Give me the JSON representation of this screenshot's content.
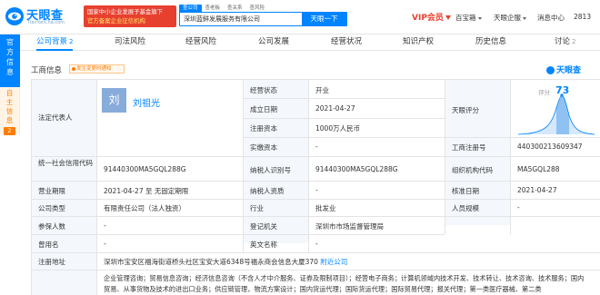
{
  "header": {
    "logo_name": "天眼查",
    "logo_domain": "TianYanCha.com",
    "promo_line1": "国家中小企业发展子基金旗下",
    "promo_line2": "官方备案企业征信机构",
    "search_tabs": [
      "查公司",
      "查老板",
      "查关系",
      "查风险"
    ],
    "search_value": "深圳蓝鲜发展服务有限公司",
    "search_button": "天眼一下",
    "vip_label": "VIP会员",
    "nav_items": [
      "百宝箱",
      "天眼企服",
      "消息中心",
      "2813"
    ],
    "colors": {
      "brand": "#0084ff",
      "promo": "#e8402f",
      "accent_orange": "#ff7d00"
    }
  },
  "sidebar": {
    "tab1": [
      "官",
      "方",
      "信",
      "息"
    ],
    "tab2": [
      "自",
      "主",
      "信",
      "息"
    ],
    "tab2_count": "2"
  },
  "tabs": [
    {
      "label": "公司背景",
      "count": "2"
    },
    {
      "label": "司法风险",
      "count": ""
    },
    {
      "label": "经营风险",
      "count": ""
    },
    {
      "label": "公司发展",
      "count": ""
    },
    {
      "label": "经营状况",
      "count": ""
    },
    {
      "label": "知识产权",
      "count": ""
    },
    {
      "label": "历史信息",
      "count": ""
    },
    {
      "label": "讨论",
      "count": "2"
    }
  ],
  "section": {
    "title": "工商信息",
    "badge": "发生变更时通知",
    "brand": "天眼查"
  },
  "info": {
    "legal_rep_label": "法定代表人",
    "avatar_char": "刘",
    "legal_rep_name": "刘祖光",
    "status_label": "经营状态",
    "status_value": "开业",
    "established_label": "成立日期",
    "established_value": "2021-04-27",
    "reg_capital_label": "注册资本",
    "reg_capital_value": "1000万人民币",
    "paid_capital_label": "实缴资本",
    "paid_capital_value": "-",
    "score_label": "天眼评分",
    "score_caption": "评分",
    "score_value": "73",
    "business_no_label": "工商注册号",
    "business_no_value": "440300213609347",
    "credit_code_label": "统一社会信用代码",
    "credit_code_value": "91440300MA5GQL288G",
    "taxpayer_id_label": "纳税人识别号",
    "taxpayer_id_value": "91440300MA5GQL288G",
    "org_code_label": "组织机构代码",
    "org_code_value": "MA5GQL288",
    "term_label": "营业期限",
    "term_value": "2021-04-27 至 无固定期限",
    "taxpayer_qual_label": "纳税人资质",
    "taxpayer_qual_value": "-",
    "approval_date_label": "核准日期",
    "approval_date_value": "2021-04-27",
    "company_type_label": "公司类型",
    "company_type_value": "有限责任公司（法人独资）",
    "industry_label": "行业",
    "industry_value": "批发业",
    "staff_size_label": "人员规模",
    "staff_size_value": "-",
    "insured_label": "参保人数",
    "insured_value": "-",
    "authority_label": "登记机关",
    "authority_value": "深圳市市场监督管理局",
    "former_name_label": "曾用名",
    "former_name_value": "-",
    "english_name_label": "英文名称",
    "english_name_value": "-",
    "address_label": "注册地址",
    "address_value": "深圳市宝安区福海街道桥头社区宝安大道6348号福永商会信息大厦370",
    "address_link": "附近公司",
    "scope_line1": "企业管理咨询；贸易信息咨询；经济信息咨询（不含人才中介服务、证券及限制项目）；经营电子商务；计算机领域内技术开发、技术转让、技术咨询、技术服务；国内",
    "scope_line2": "贸易、从事货物及技术的进出口业务；供应链管理，物流方案设计；国内货运代理；国际货运代理；国际贸易代理；报关代理；第一类医疗器械、第二类"
  }
}
